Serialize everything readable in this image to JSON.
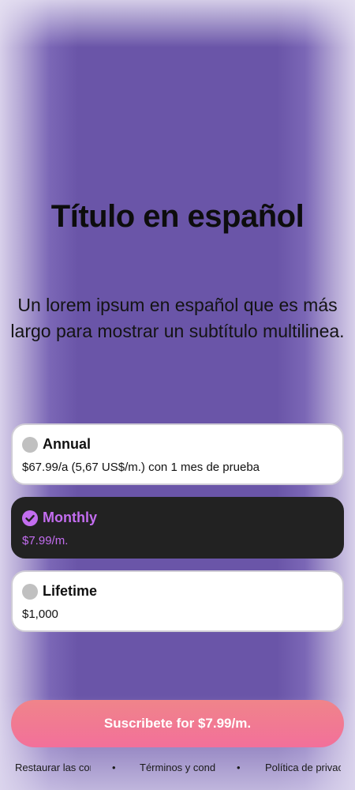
{
  "title": "Título en español",
  "subtitle": "Un lorem ipsum en español que es más largo para mostrar un subtítulo multilinea.",
  "plans": [
    {
      "name": "Annual",
      "price": "$67.99/a (5,67 US$/m.) con 1 mes de prueba",
      "selected": false
    },
    {
      "name": "Monthly",
      "price": "$7.99/m.",
      "selected": true
    },
    {
      "name": "Lifetime",
      "price": "$1,000",
      "selected": false
    }
  ],
  "cta_label": "Suscribete for $7.99/m.",
  "footer": {
    "restore": "Restaurar las compras",
    "terms": "Términos y condiciones",
    "privacy": "Política de privacidad",
    "separator": "•"
  },
  "colors": {
    "background": "#6a55a8",
    "accent": "#c36df0",
    "selected_card": "#222222",
    "cta_gradient_top": "#f0848a",
    "cta_gradient_bottom": "#f2709a"
  },
  "icons": {
    "selected_radio": "check-circle-icon",
    "unselected_radio": "empty-circle-icon"
  }
}
